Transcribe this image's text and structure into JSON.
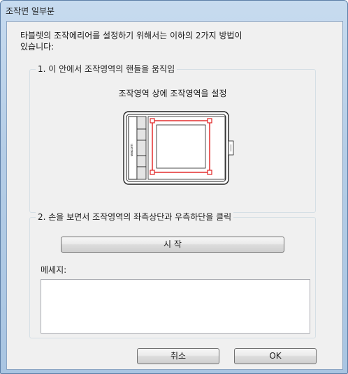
{
  "window": {
    "title": "조작면 일부분"
  },
  "intro": {
    "line1": "타블렛의 조작에리어를 설정하기 위해서는 이하의 2가지 방법이",
    "line2": "있습니다:"
  },
  "group1": {
    "label": "1. 이 안에서 조작영역의 핸들을 움직임",
    "caption": "조작영역 상에 조작영역을 설정",
    "tablet": {
      "logo": "wacom"
    }
  },
  "group2": {
    "label": "2. 손을 보면서 조작영역의 좌측상단과 우측하단을 클릭",
    "start_button": "시 작",
    "message_label": "메세지:",
    "message_value": ""
  },
  "buttons": {
    "cancel": "취소",
    "ok": "OK"
  },
  "colors": {
    "handle": "#e02020",
    "title_bar": "#b9d1ea"
  }
}
